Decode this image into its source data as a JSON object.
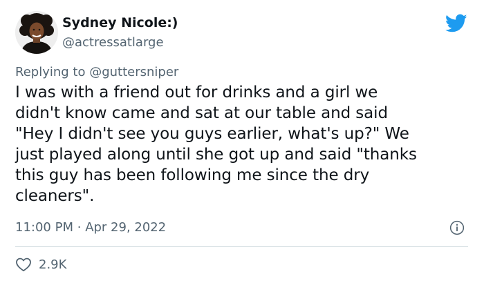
{
  "author": {
    "display_name": "Sydney Nicole:)",
    "handle": "@actressatlarge"
  },
  "reply_context": {
    "prefix": "Replying to ",
    "target": "@guttersniper"
  },
  "tweet": {
    "lines": [
      "I was with a friend out for drinks and a girl we",
      "didn't know came and sat at our table and said",
      "\"Hey I didn't see you guys earlier, what's up?\" We",
      "just played along until she got up and said \"thanks",
      "this guy has been following me since the dry",
      "cleaners\"."
    ],
    "time": "11:00 PM",
    "separator": "·",
    "date": "Apr 29, 2022"
  },
  "engagement": {
    "likes": "2.9K"
  },
  "icons": {
    "logo": "twitter-bird-icon",
    "info": "info-icon",
    "like": "heart-icon"
  },
  "colors": {
    "brand": "#1d9bf0",
    "text": "#0f1419",
    "secondary_text": "#536471",
    "divider": "#cfd9de"
  }
}
